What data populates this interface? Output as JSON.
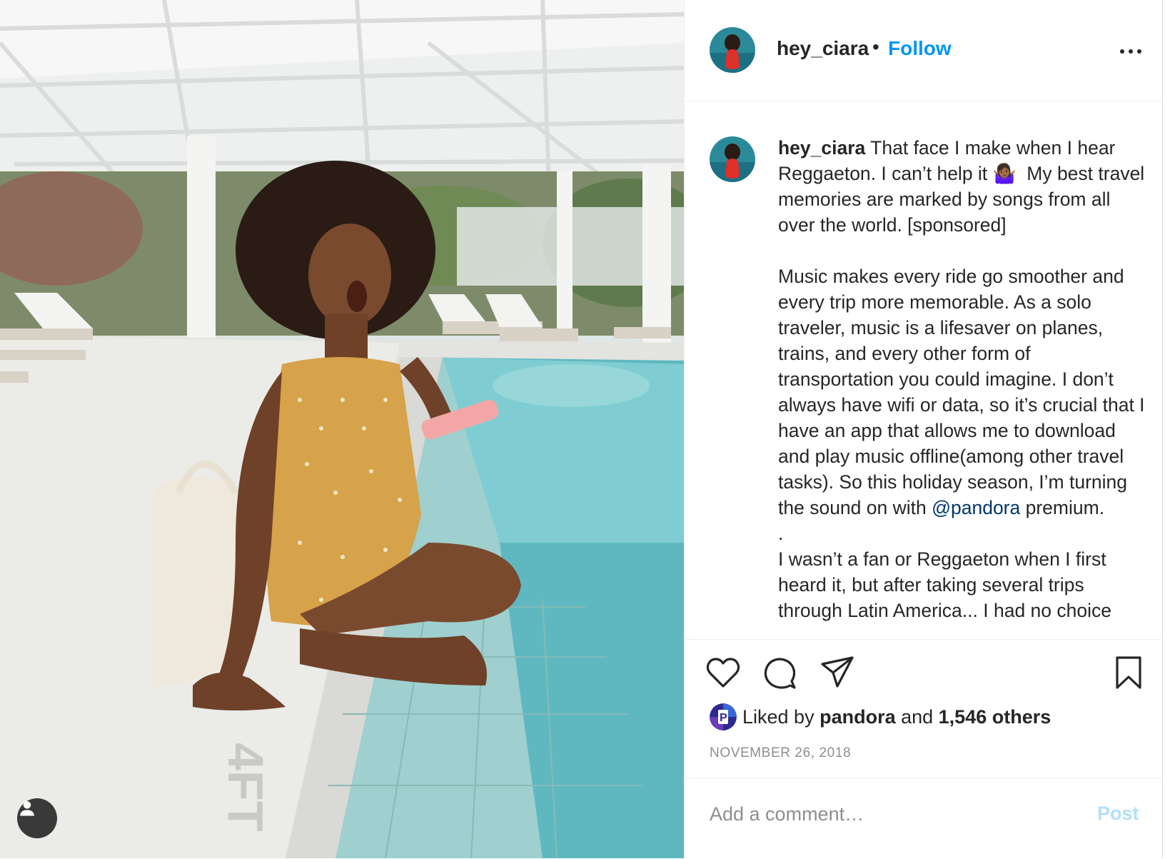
{
  "post": {
    "username": "hey_ciara",
    "separator": "•",
    "follow_label": "Follow",
    "more_icon": "more-horizontal-icon"
  },
  "photo": {
    "description_icon": "tagged-user-icon",
    "floor_mark": "4FT"
  },
  "caption": {
    "username": "hey_ciara",
    "text_before_mention": " That face I make when I hear Reggaeton. I can’t help it 🤷🏾‍♀️  My best travel memories are marked by songs from all over the world. [sponsored]\n\nMusic makes every ride go smoother and every trip more memorable. As a solo traveler, music is a lifesaver on planes, trains, and every other form of transportation you could imagine. I don’t always have wifi or data, so it’s crucial that I have an app that allows me to download and play music offline(among other travel tasks). So this holiday season, I’m turning the sound on with ",
    "mention": "@pandora",
    "text_after_mention": " premium.\n.\nI wasn’t a fan or Reggaeton when I first heard it, but after taking several trips through Latin America... I had no choice"
  },
  "actions": {
    "like_icon": "heart-icon",
    "comment_icon": "comment-icon",
    "share_icon": "paper-plane-icon",
    "save_icon": "bookmark-icon"
  },
  "likes": {
    "prefix": "Liked by ",
    "user": "pandora",
    "middle": " and ",
    "count": "1,546 others",
    "avatar_letter": "P"
  },
  "date": "NOVEMBER 26, 2018",
  "comment": {
    "placeholder": "Add a comment…",
    "post_label": "Post"
  },
  "colors": {
    "follow": "#0095f6",
    "mention": "#00376b",
    "post_disabled": "#b2dffc",
    "muted": "#8e8e8e",
    "text": "#262626"
  }
}
